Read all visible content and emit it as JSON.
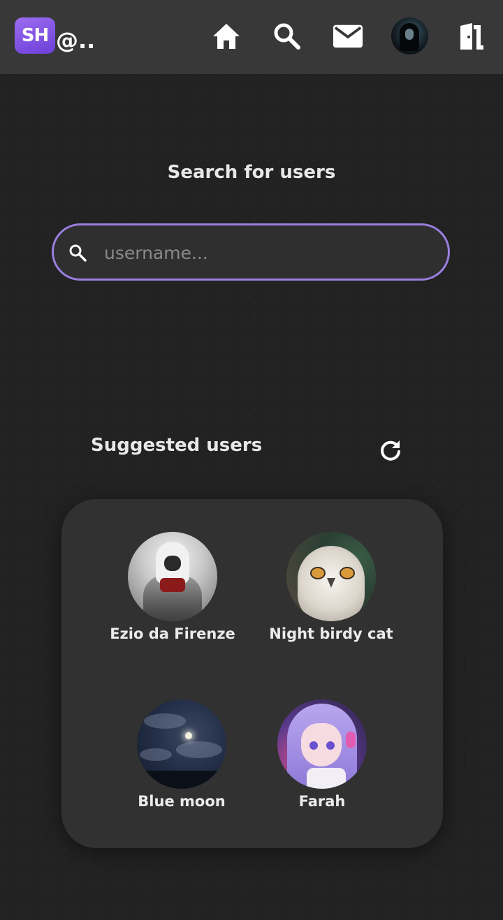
{
  "header": {
    "logo_text": "SH",
    "logo_suffix": "@..",
    "nav": [
      {
        "icon": "home-icon"
      },
      {
        "icon": "search-icon"
      },
      {
        "icon": "mail-icon"
      },
      {
        "icon": "profile-avatar"
      },
      {
        "icon": "logout-door-icon"
      }
    ]
  },
  "search": {
    "title": "Search for users",
    "placeholder": "username..."
  },
  "suggested": {
    "title": "Suggested users",
    "refresh_icon": "refresh-icon",
    "users": [
      {
        "name": "Ezio da Firenze"
      },
      {
        "name": "Night birdy cat"
      },
      {
        "name": "Blue moon"
      },
      {
        "name": "Farah"
      }
    ]
  },
  "colors": {
    "background": "#222222",
    "topbar": "#383838",
    "accent": "#9b7fe0",
    "logo_gradient_start": "#9b6cf0",
    "logo_gradient_end": "#6d3fd8",
    "card": "#313131"
  }
}
